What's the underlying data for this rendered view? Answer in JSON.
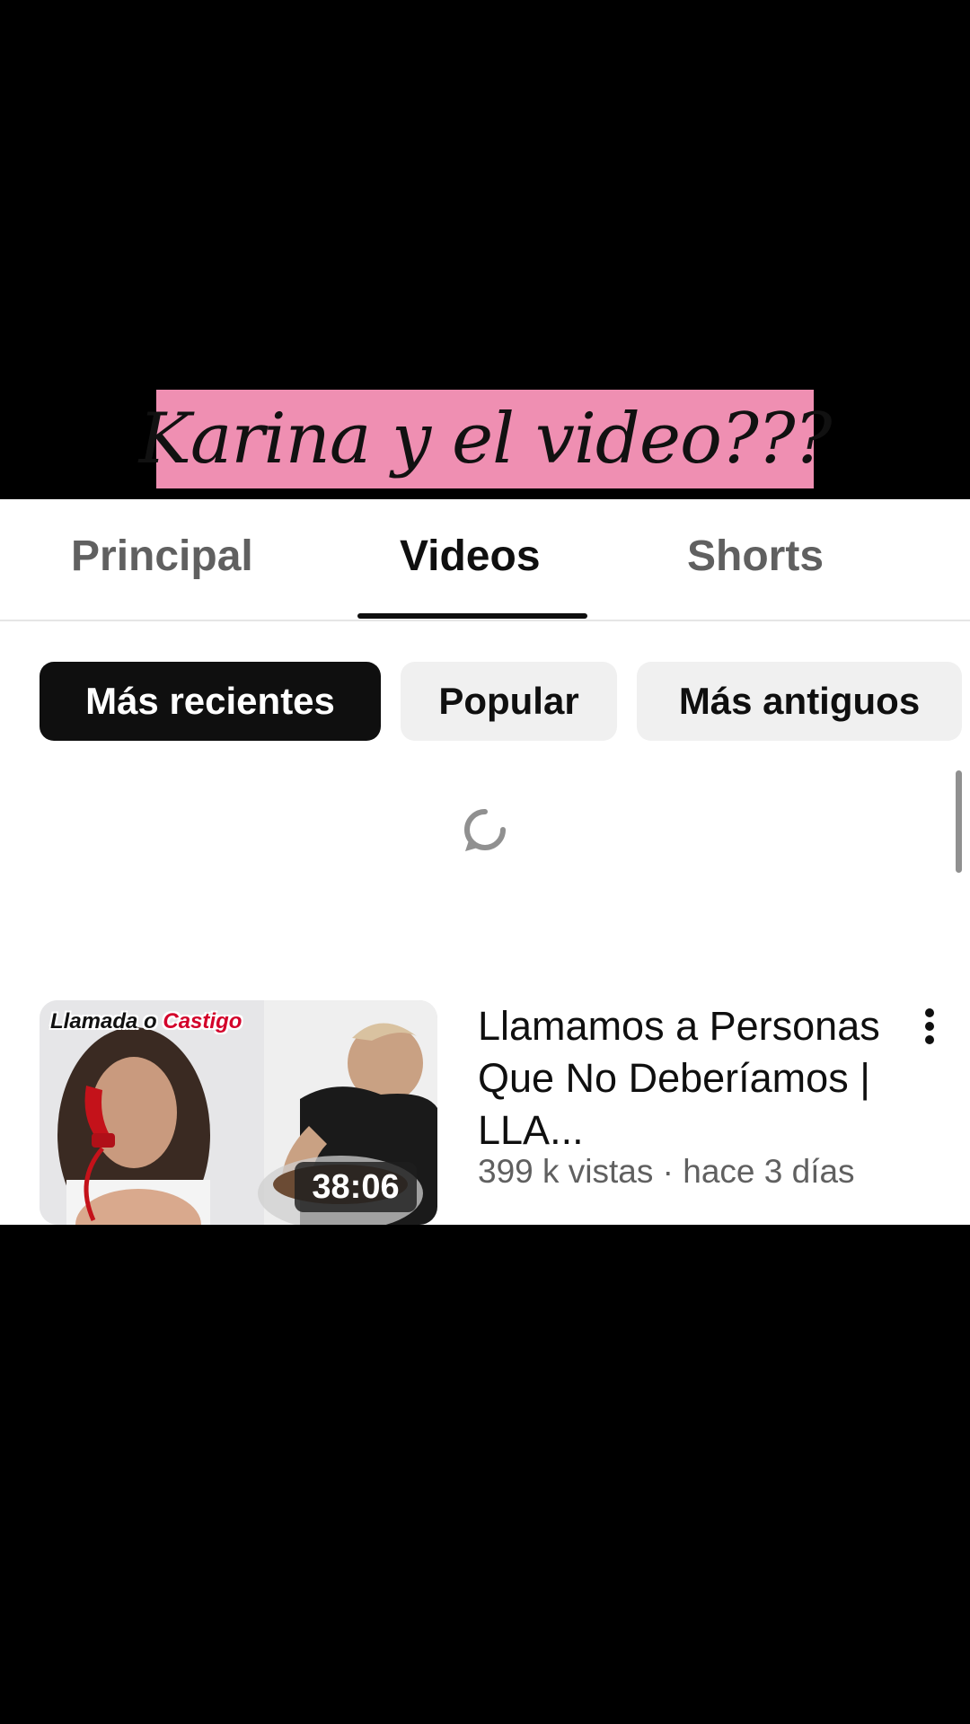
{
  "caption": {
    "text": "Karina y el video???",
    "background": "#ef8fb2"
  },
  "tabs": [
    {
      "label": "Principal",
      "active": false
    },
    {
      "label": "Videos",
      "active": true
    },
    {
      "label": "Shorts",
      "active": false
    }
  ],
  "chips": [
    {
      "label": "Más recientes",
      "selected": true
    },
    {
      "label": "Popular",
      "selected": false
    },
    {
      "label": "Más antiguos",
      "selected": false
    }
  ],
  "loading": {
    "icon": "refresh-spinner-icon"
  },
  "video": {
    "thumbnail_tag_part1": "Llamada o",
    "thumbnail_tag_part2": "Castigo",
    "duration": "38:06",
    "title": "Llamamos a Personas Que No Deberíamos | LLA...",
    "meta": "399 k vistas · hace 3 días",
    "menu_icon": "more-vertical-icon"
  },
  "colors": {
    "active_chip": "#0f0f0f",
    "inactive_chip": "#f0f0f0",
    "secondary_text": "#606060",
    "tag_red": "#d3002a"
  }
}
